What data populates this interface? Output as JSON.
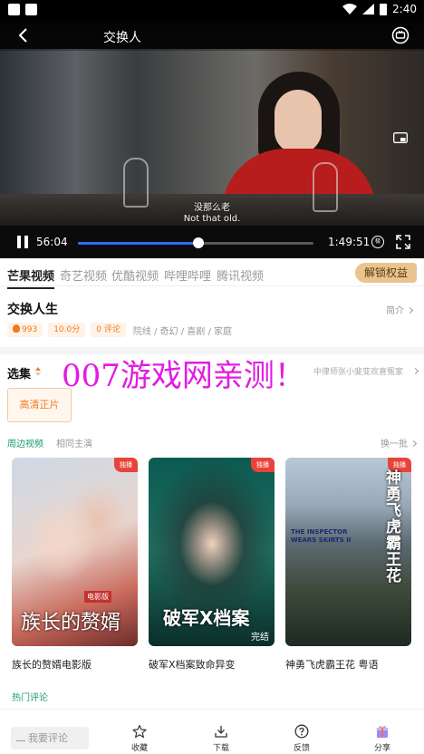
{
  "status_bar": {
    "time": "2:40"
  },
  "player": {
    "title": "交换人",
    "subtitle_cn": "没那么老",
    "subtitle_en": "Not that old.",
    "current_time": "56:04",
    "total_time": "1:49:51",
    "progress": 0.51,
    "quality_label": "极"
  },
  "platforms": {
    "items": [
      "芒果视频",
      "奇艺视频",
      "优酷视频",
      "哔哩哔哩",
      "腾讯视频"
    ],
    "active_index": 0,
    "unlock_label": "解锁权益"
  },
  "show": {
    "title": "交换人生",
    "intro_label": "简介",
    "heat": "993",
    "score": "10.0分",
    "comments": "0 评论",
    "genres": "院线 / 奇幻 / 喜剧 / 家庭"
  },
  "episodes": {
    "label": "选集",
    "info": "中律师张小斐变欢喜冤家",
    "chip": "高清正片"
  },
  "watermark": "007游戏网亲测！",
  "recommendations": {
    "tabs": [
      "周边视频",
      "相同主演"
    ],
    "refresh_label": "换一批",
    "badge": "独播",
    "cards": [
      {
        "title": "族长的赘婿电影版",
        "poster_text": "族长的赘婿",
        "poster_tag": "电影版"
      },
      {
        "title": "破军X档案致命异变",
        "poster_text": "破军X档案",
        "poster_tag": "完结"
      },
      {
        "title": "神勇飞虎霸王花 粤语",
        "poster_text": "神勇飞虎霸王花",
        "poster_tag": "THE INSPECTOR WEARS SKIRTS II"
      }
    ]
  },
  "comments_section": {
    "label": "热门评论"
  },
  "bottom_bar": {
    "comment_placeholder": "我要评论",
    "actions": [
      "收藏",
      "下载",
      "反馈",
      "分享"
    ]
  },
  "colors": {
    "accent_green": "#1b9a6b",
    "accent_orange": "#f07a1f",
    "progress_blue": "#2b6df0",
    "watermark": "#e21be3"
  }
}
